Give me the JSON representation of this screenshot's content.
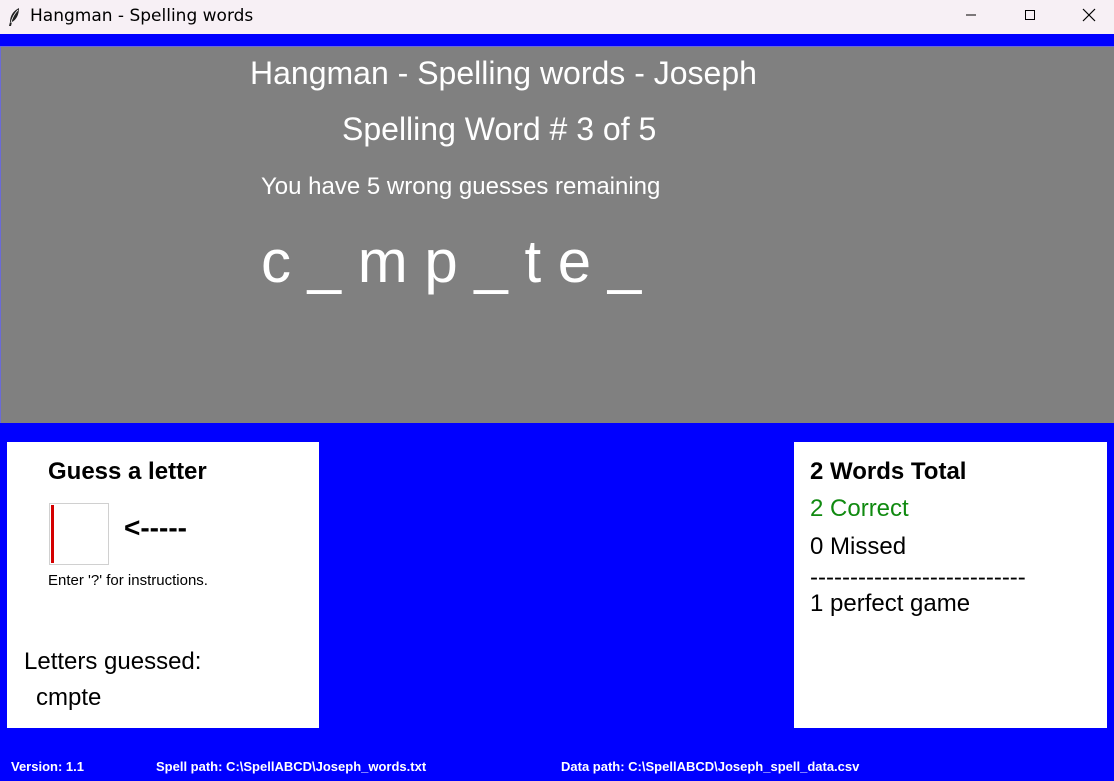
{
  "window": {
    "title": "Hangman - Spelling words",
    "icon": "feather-icon",
    "controls": [
      "minimize-icon",
      "maximize-icon",
      "close-icon"
    ]
  },
  "display": {
    "headline": "Hangman - Spelling words - Joseph",
    "word_number": "Spelling Word # 3 of 5",
    "remaining": "You have 5 wrong guesses remaining",
    "masked_word": "c _ m p _ t e _"
  },
  "guess": {
    "heading": "Guess a letter",
    "input_value": "",
    "arrow": "<-----",
    "instructions": "Enter '?' for instructions.",
    "letters_heading": "Letters guessed:",
    "letters_value": "cmpte"
  },
  "stats": {
    "total": "2 Words Total",
    "correct": "2 Correct",
    "missed": "0 Missed",
    "divider": "---------------------------",
    "perfect": "1 perfect game"
  },
  "footer": {
    "version": "Version: 1.1",
    "spell_path": "Spell path: C:\\SpellABCD\\Joseph_words.txt",
    "data_path": "Data path: C:\\SpellABCD\\Joseph_spell_data.csv"
  },
  "colors": {
    "background": "#0000ff",
    "display": "#808080",
    "panel": "#ffffff",
    "correct": "#108a10",
    "cursor": "#d40000"
  }
}
